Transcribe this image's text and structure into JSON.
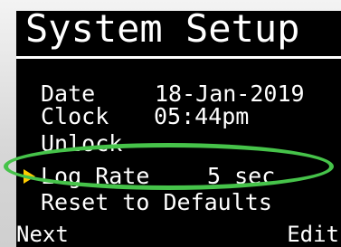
{
  "screen": {
    "title": "System Setup"
  },
  "menu": {
    "items": [
      {
        "label": "Date",
        "value": "18-Jan-2019"
      },
      {
        "label": "Clock",
        "value": "05:44pm"
      },
      {
        "label": "Unlock",
        "value": ""
      },
      {
        "label": "Log Rate",
        "value": "5 sec",
        "selected": true
      },
      {
        "label": "Reset to Defaults",
        "value": ""
      }
    ]
  },
  "softkeys": {
    "left": "Next",
    "right": "Edit"
  },
  "colors": {
    "background": "#000000",
    "text": "#ffffff",
    "pointer": "#ffcc00",
    "highlight_ring": "#46c34a"
  },
  "icons": {
    "selection_pointer": "triangle-right-icon"
  }
}
